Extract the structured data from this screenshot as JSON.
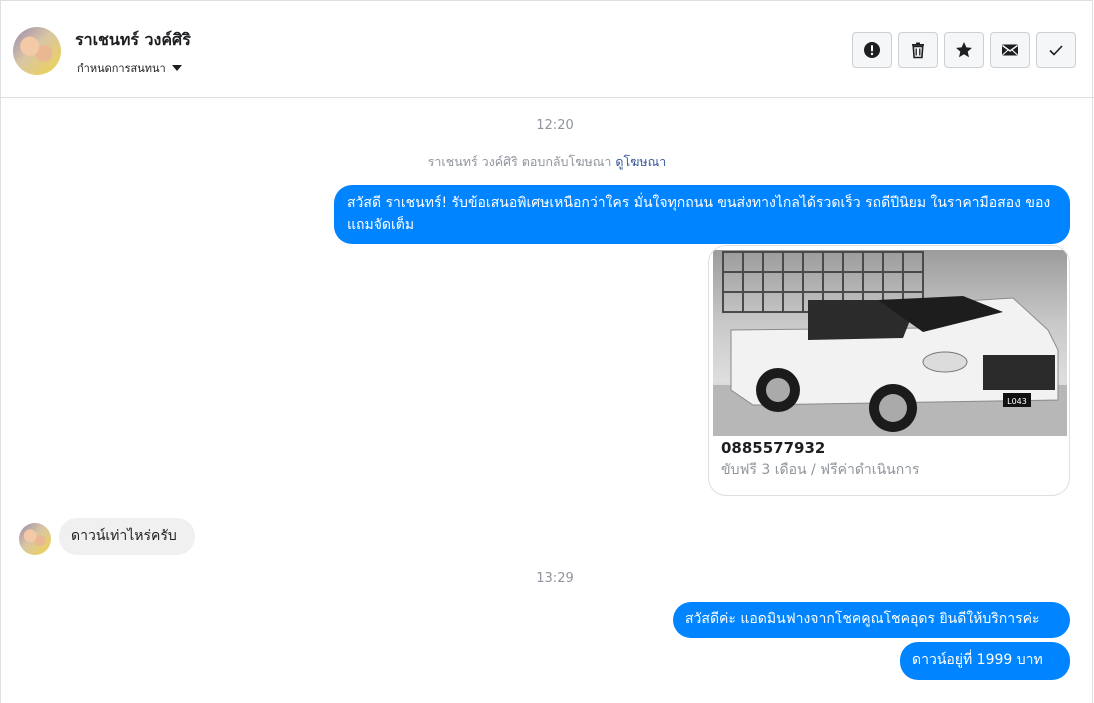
{
  "contact": {
    "name": "ราเชนทร์ วงค์ศิริ",
    "subtitle": "กำหนดการสนทนา"
  },
  "toolbar": {
    "buttons": [
      {
        "icon": "alert-icon",
        "label": "Report"
      },
      {
        "icon": "trash-icon",
        "label": "Delete"
      },
      {
        "icon": "star-icon",
        "label": "Star"
      },
      {
        "icon": "envelope-icon",
        "label": "Mark unread"
      },
      {
        "icon": "check-icon",
        "label": "Done"
      }
    ]
  },
  "conversation": {
    "time1": "12:20",
    "system_text": "ราเชนทร์ วงค์ศิริ ตอบกลับโฆษณา",
    "system_link": "ดูโฆษณา",
    "ad_message": "สวัสดี ราเชนทร์! รับข้อเสนอพิเศษเหนือกว่าใคร  มั่นใจทุกถนน ขนส่งทางไกลได้รวดเร็ว รถดีปีนิยม ในราคามือสอง ของแถมจัดเต็ม",
    "ad_card": {
      "title": "0885577932",
      "subtitle": "ขับฟรี 3 เดือน / ฟรีค่าดำเนินการ",
      "plate": "L043"
    },
    "incoming_message": "ดาวน์เท่าไหร่ครับ",
    "time2": "13:29",
    "reply1": "สวัสดีค่ะ แอดมินฟางจากโชคคูณโชคอุดร ยินดีให้บริการค่ะ",
    "reply2": "ดาวน์อยู่ที่  1999  บาท"
  },
  "colors": {
    "accent": "#0084ff",
    "incoming_bubble": "#f1f0f0",
    "muted_text": "#90949c",
    "link": "#365899"
  }
}
